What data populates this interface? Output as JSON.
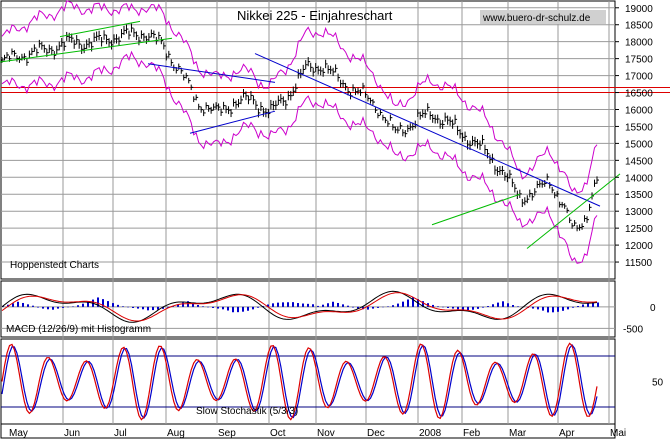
{
  "chart_data": [
    {
      "type": "line",
      "title": "Nikkei 225 - Einjahreschart",
      "watermark": "www.buero-dr-schulz.de",
      "source_label": "Hoppenstedt Charts",
      "ylim": [
        11000,
        19200
      ],
      "yticks": [
        11500,
        12000,
        12500,
        13000,
        13500,
        14000,
        14500,
        15000,
        15500,
        16000,
        16500,
        17000,
        17500,
        18000,
        18500,
        19000
      ],
      "xticks": [
        "May",
        "Jun",
        "Jul",
        "Aug",
        "Sep",
        "Oct",
        "Nov",
        "Dec",
        "2008",
        "Feb",
        "Mar",
        "Apr",
        "Mai"
      ],
      "grid": true,
      "price_close_series": [
        {
          "t": 0.0,
          "v": 17400
        },
        {
          "t": 0.03,
          "v": 17600
        },
        {
          "t": 0.06,
          "v": 17700
        },
        {
          "t": 0.09,
          "v": 17850
        },
        {
          "t": 0.12,
          "v": 18000
        },
        {
          "t": 0.15,
          "v": 17950
        },
        {
          "t": 0.18,
          "v": 18100
        },
        {
          "t": 0.21,
          "v": 18200
        },
        {
          "t": 0.24,
          "v": 18250
        },
        {
          "t": 0.27,
          "v": 17900
        },
        {
          "t": 0.3,
          "v": 17100
        },
        {
          "t": 0.33,
          "v": 16200
        },
        {
          "t": 0.36,
          "v": 15900
        },
        {
          "t": 0.39,
          "v": 16200
        },
        {
          "t": 0.42,
          "v": 16300
        },
        {
          "t": 0.45,
          "v": 15900
        },
        {
          "t": 0.48,
          "v": 16400
        },
        {
          "t": 0.51,
          "v": 17200
        },
        {
          "t": 0.54,
          "v": 17300
        },
        {
          "t": 0.57,
          "v": 16800
        },
        {
          "t": 0.6,
          "v": 16500
        },
        {
          "t": 0.63,
          "v": 16100
        },
        {
          "t": 0.66,
          "v": 15300
        },
        {
          "t": 0.69,
          "v": 15600
        },
        {
          "t": 0.72,
          "v": 15900
        },
        {
          "t": 0.75,
          "v": 15600
        },
        {
          "t": 0.78,
          "v": 15200
        },
        {
          "t": 0.81,
          "v": 14800
        },
        {
          "t": 0.84,
          "v": 14200
        },
        {
          "t": 0.87,
          "v": 13400
        },
        {
          "t": 0.9,
          "v": 13600
        },
        {
          "t": 0.92,
          "v": 13900
        },
        {
          "t": 0.94,
          "v": 13300
        },
        {
          "t": 0.96,
          "v": 12400
        },
        {
          "t": 0.98,
          "v": 12800
        },
        {
          "t": 1.0,
          "v": 13900
        }
      ],
      "support_lines": [
        16650,
        16500
      ],
      "macd": {
        "label": "MACD (12/26/9) mit Histogramm",
        "ylim": [
          -700,
          600
        ],
        "yticks": [
          0,
          -500
        ],
        "histogram_pattern": [
          30,
          60,
          90,
          120,
          90,
          60,
          30,
          -20,
          -60,
          -100,
          -140,
          -100,
          -60,
          -20,
          20,
          60,
          100,
          140,
          180,
          220,
          180,
          140,
          100,
          60,
          20,
          -20,
          -60,
          -100,
          -140,
          -180,
          -140,
          -100,
          -60,
          -20,
          20,
          60,
          100,
          140,
          100,
          60,
          20,
          -20,
          -60,
          -100,
          -140,
          -180,
          -220,
          -180,
          -140,
          -100,
          -60,
          -20,
          20,
          60,
          100,
          140,
          180,
          220,
          260,
          220,
          180,
          140,
          100
        ]
      },
      "stochastic": {
        "label": "Slow Stochastik (5/3/3)",
        "ylim": [
          0,
          100
        ],
        "yticks": [
          50
        ],
        "bands": [
          80,
          20
        ]
      },
      "colors": {
        "price": "#000000",
        "bollinger": "#cc00cc",
        "trend_down": "#0000cc",
        "trend_up": "#00bb00",
        "support": "#dd0000",
        "macd_line": "#000000",
        "signal_line": "#dd0000",
        "histogram": "#0000cc",
        "stoch_k": "#dd0000",
        "stoch_d": "#0000cc",
        "band": "#000080"
      }
    }
  ]
}
